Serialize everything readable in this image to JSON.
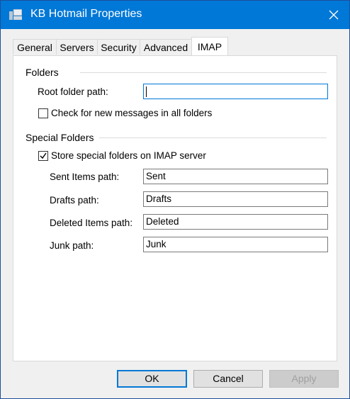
{
  "window": {
    "title": "KB Hotmail Properties",
    "icons": {
      "app": "mailbox-properties-icon",
      "close": "close-icon"
    }
  },
  "tabs": [
    {
      "label": "General",
      "active": false
    },
    {
      "label": "Servers",
      "active": false
    },
    {
      "label": "Security",
      "active": false
    },
    {
      "label": "Advanced",
      "active": false
    },
    {
      "label": "IMAP",
      "active": true
    }
  ],
  "folders": {
    "title": "Folders",
    "root_label": "Root folder path:",
    "root_value": "",
    "check_all_label": "Check for new messages in all folders",
    "check_all_checked": false
  },
  "special": {
    "title": "Special Folders",
    "store_label": "Store special folders on IMAP server",
    "store_checked": true,
    "sent_label": "Sent Items path:",
    "sent_value": "Sent",
    "drafts_label": "Drafts path:",
    "drafts_value": "Drafts",
    "deleted_label": "Deleted Items path:",
    "deleted_value": "Deleted",
    "junk_label": "Junk path:",
    "junk_value": "Junk"
  },
  "buttons": {
    "ok": "OK",
    "cancel": "Cancel",
    "apply": "Apply",
    "apply_enabled": false
  },
  "colors": {
    "titlebar": "#0078d7",
    "focus": "#0078d7"
  }
}
